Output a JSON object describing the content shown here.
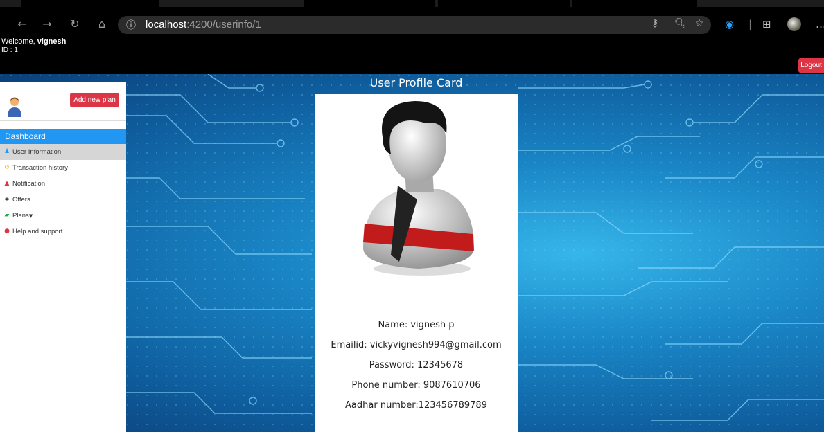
{
  "browser": {
    "url_host": "localhost",
    "url_path": ":4200/userinfo/1"
  },
  "header": {
    "welcome_prefix": "Welcome, ",
    "username": "vignesh",
    "id_text": "ID : 1",
    "logout_label": "Logout"
  },
  "sidebar": {
    "add_plan_label": "Add new plan",
    "dashboard_label": "Dashboard",
    "items": [
      {
        "label": "User Information",
        "icon": "user-icon",
        "icon_color": "#2196f3"
      },
      {
        "label": "Transaction history",
        "icon": "history-icon",
        "icon_color": "#f0ad00"
      },
      {
        "label": "Notification",
        "icon": "bell-icon",
        "icon_color": "#dc3545"
      },
      {
        "label": "Offers",
        "icon": "gem-icon",
        "icon_color": "#333333"
      },
      {
        "label": "Plans",
        "icon": "book-icon",
        "icon_color": "#28a745"
      },
      {
        "label": "Help and support",
        "icon": "chat-icon",
        "icon_color": "#dc3545"
      }
    ]
  },
  "profile": {
    "title": "User Profile Card",
    "name": "Name: vignesh p",
    "email": "Emailid: vickyvignesh994@gmail.com",
    "password": "Password: 12345678",
    "phone": "Phone number: 9087610706",
    "aadhar": "Aadhar number:123456789789"
  },
  "colors": {
    "accent_red": "#dc3545",
    "dashboard_blue": "#2196f3"
  }
}
